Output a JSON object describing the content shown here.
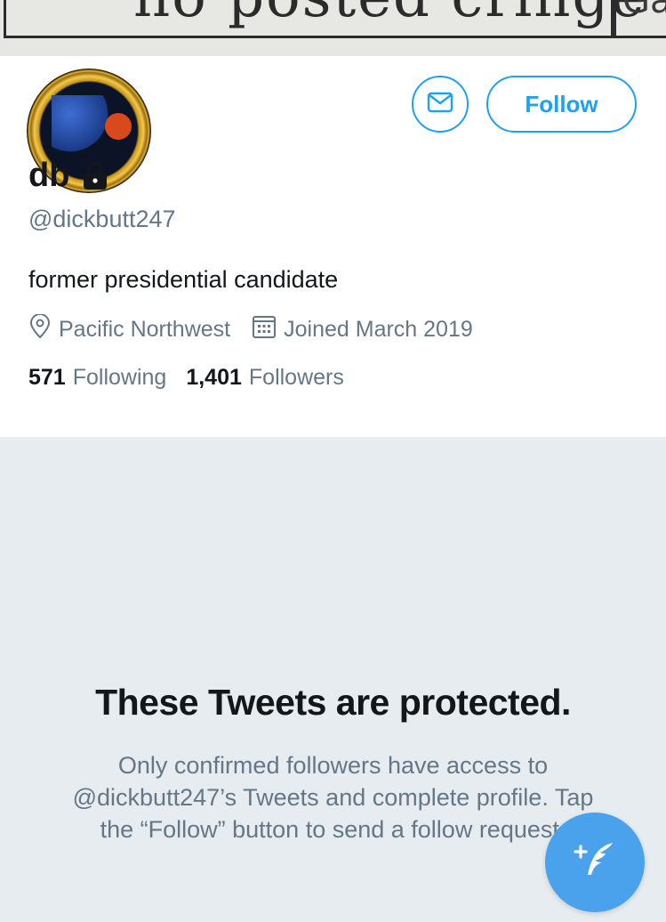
{
  "banner": {
    "text": "no posted cringe",
    "side_text": "Ga"
  },
  "profile": {
    "display_name": "db",
    "handle": "@dickbutt247",
    "bio": "former presidential candidate",
    "location": "Pacific Northwest",
    "joined": "Joined March 2019",
    "following_count": "571",
    "following_label": "Following",
    "followers_count": "1,401",
    "followers_label": "Followers"
  },
  "actions": {
    "follow_label": "Follow"
  },
  "protected": {
    "title": "These Tweets are protected.",
    "description": "Only confirmed followers have access to @dickbutt247’s Tweets and complete profile. Tap the “Follow” button to send a follow request."
  },
  "colors": {
    "accent": "#1da1f2",
    "fab": "#4aa1ec",
    "muted_text": "#657786",
    "page_background": "#e6ecf0"
  },
  "icons": [
    "mail-icon",
    "lock-icon",
    "location-pin-icon",
    "calendar-icon",
    "compose-tweet-icon"
  ]
}
